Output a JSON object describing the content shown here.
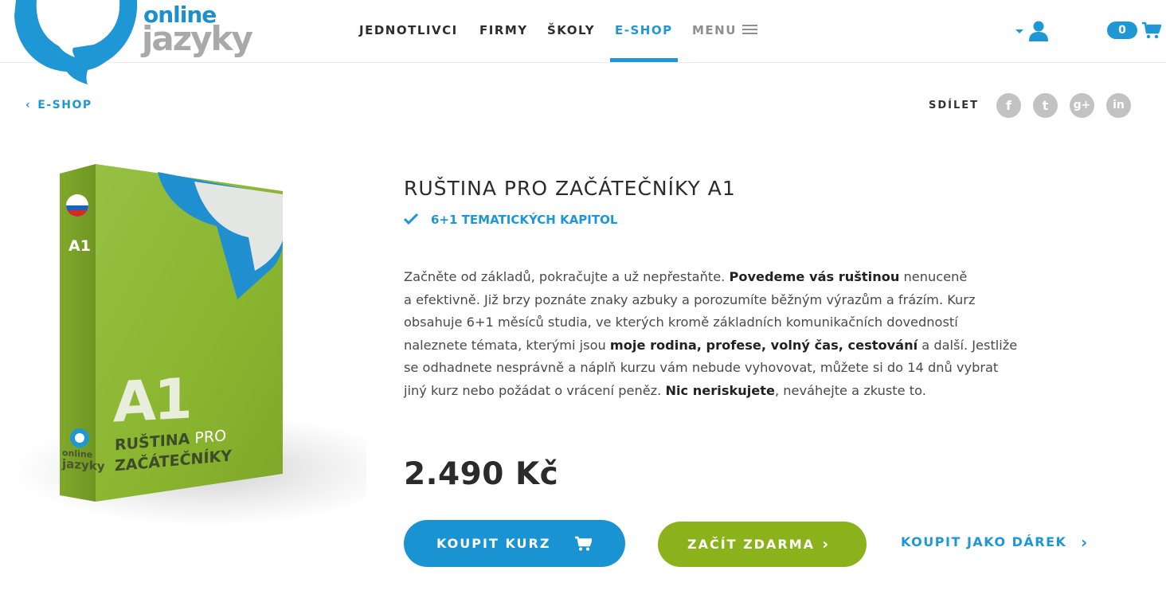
{
  "brand": {
    "line1": "online",
    "line2": "jazyky",
    "blue": "#1f97d4",
    "grey": "#a9a9a9"
  },
  "nav": {
    "items": [
      {
        "label": "JEDNOTLIVCI"
      },
      {
        "label": "FIRMY"
      },
      {
        "label": "ŠKOLY"
      },
      {
        "label": "E-SHOP",
        "active": true
      },
      {
        "label": "MENU",
        "icon": "hamburger-icon"
      }
    ],
    "user_icon": "user-icon",
    "cart_count": "0",
    "cart_icon": "cart-icon"
  },
  "subbar": {
    "back_label": "E-SHOP",
    "share_label": "SDÍLET",
    "social": [
      {
        "icon": "facebook-icon",
        "glyph": "f"
      },
      {
        "icon": "twitter-icon",
        "glyph": "t"
      },
      {
        "icon": "google-plus-icon",
        "glyph": "g+"
      },
      {
        "icon": "linkedin-icon",
        "glyph": "in"
      }
    ]
  },
  "product": {
    "box": {
      "level_small": "A1",
      "level_big": "A1",
      "name_line1_bold": "RUŠTINA",
      "name_line1_light": " PRO",
      "name_line2": "ZAČÁTEČNÍKY",
      "logo_text1": "online",
      "logo_text2": "jazyky",
      "green": "#8ab52f"
    },
    "title": "RUŠTINA PRO ZAČÁTEČNÍKY A1",
    "feature": "6+1 TEMATICKÝCH KAPITOL",
    "description": {
      "l1a": "Začněte od základů, pokračujte a už nepřestaňte. ",
      "l1b": "Povedeme vás ruštinou",
      "l1c": " nenuceně",
      "l2": "a efektivně. Již brzy poznáte znaky azbuky a porozumíte běžným výrazům a frázím. Kurz",
      "l3": "obsahuje 6+1 měsíců studia, ve kterých kromě základních komunikačních dovedností",
      "l4a": "naleznete témata, kterými jsou ",
      "l4b": "moje rodina, profese, volný čas, cestování",
      "l4c": " a další. Jestliže",
      "l5": "se odhadnete nesprávně a náplň kurzu vám nebude vyhovovat, můžete si do 14 dnů vybrat",
      "l6a": "jiný kurz nebo požádat o vrácení peněz. ",
      "l6b": "Nic neriskujete",
      "l6c": ", neváhejte a zkuste to."
    },
    "price": "2.490 Kč",
    "buy_label": "KOUPIT KURZ",
    "free_label": "ZAČÍT ZDARMA",
    "gift_label": "KOUPIT JAKO DÁREK",
    "colors": {
      "buy": "#1a93d3",
      "free": "#8bb21b"
    }
  }
}
